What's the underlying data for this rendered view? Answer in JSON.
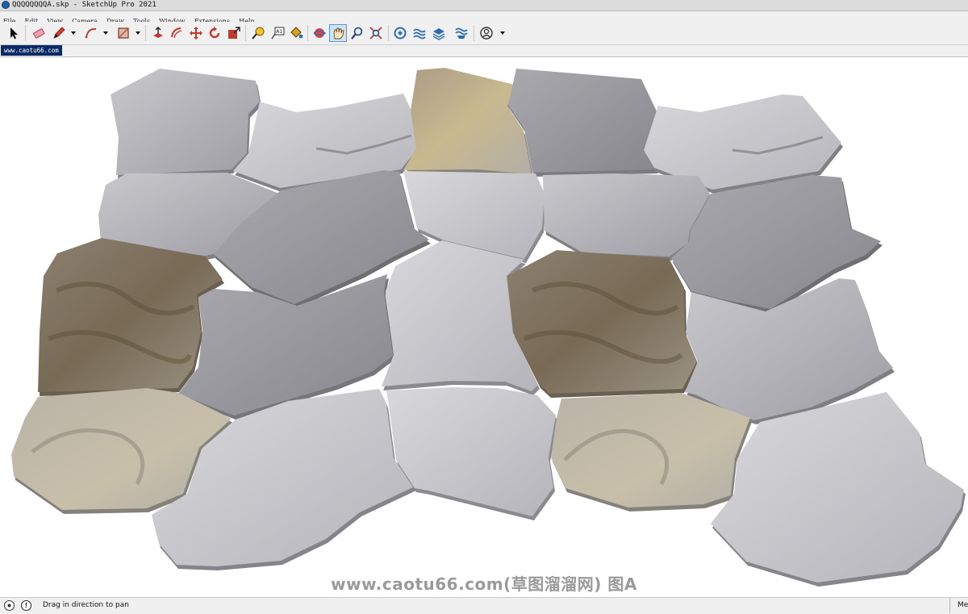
{
  "window": {
    "title": "QQQQQQQQA.skp - SketchUp Pro 2021"
  },
  "menu": [
    "File",
    "Edit",
    "View",
    "Camera",
    "Draw",
    "Tools",
    "Window",
    "Extensions",
    "Help"
  ],
  "toolbar": {
    "tools": [
      "select-icon",
      "eraser-icon",
      "pencil-icon",
      "arc-icon",
      "rectangle-icon",
      "push-pull-icon",
      "offset-icon",
      "move-icon",
      "rotate-icon",
      "scale-icon",
      "tape-measure-icon",
      "text-icon",
      "paint-bucket-icon",
      "orbit-icon",
      "pan-icon",
      "zoom-icon",
      "zoom-extents-icon",
      "warehouse-icon",
      "extension-warehouse-icon",
      "layout-icon",
      "extension-manager-icon",
      "account-icon"
    ],
    "active_tool": "pan-icon",
    "text_tool_label": "A1"
  },
  "scene_tab": {
    "label": "www.caotu66.com"
  },
  "viewport": {
    "background": "#ffffff",
    "model": "irregular flagstone paving tiles",
    "watermark": "www.caotu66.com(草图溜溜网) 图A"
  },
  "status": {
    "message": "Drag in direction to pan",
    "right_text": "Me"
  },
  "colors": {
    "accent_active": "#cfe3f6",
    "scene_tab_bg": "#0a2a66",
    "app_icon": "#1f5fa8"
  }
}
